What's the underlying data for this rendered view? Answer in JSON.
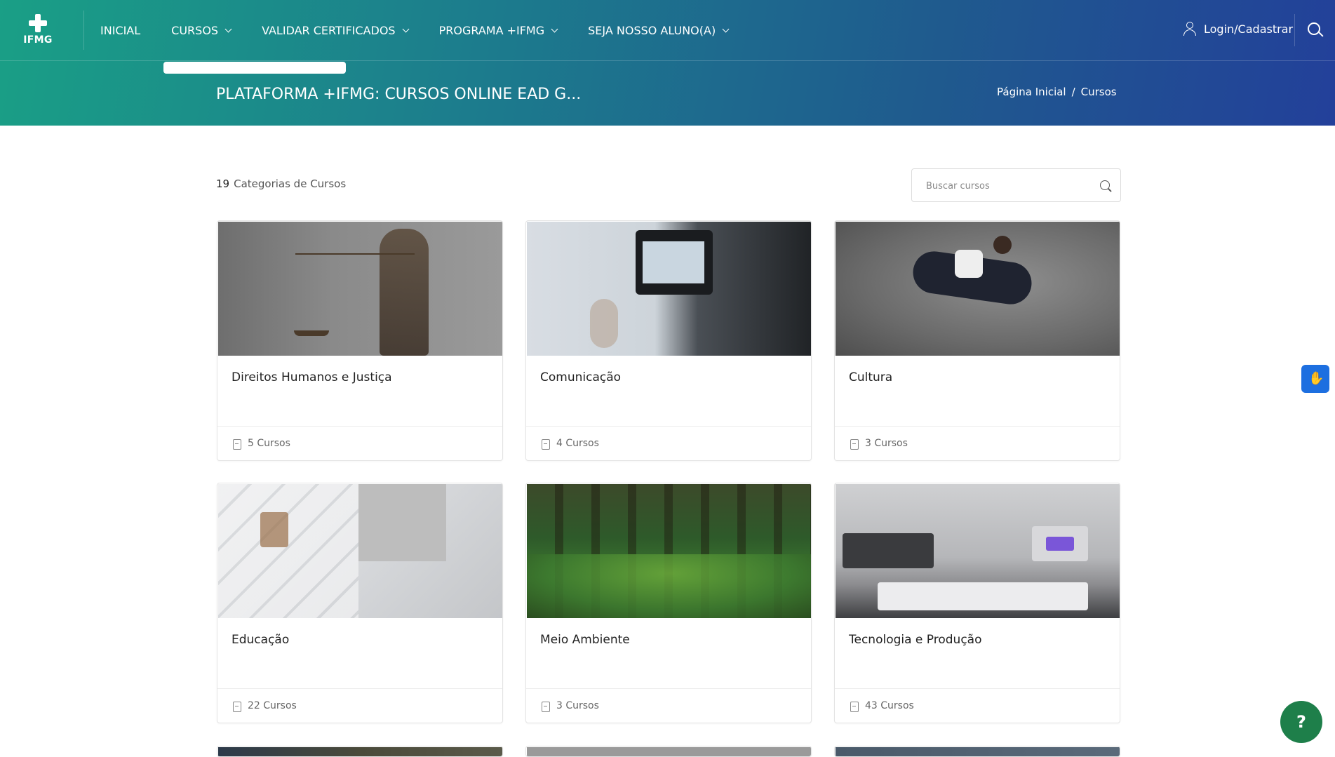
{
  "header": {
    "logo_text": "IFMG",
    "nav": [
      {
        "label": "INICIAL",
        "dropdown": false
      },
      {
        "label": "CURSOS",
        "dropdown": true
      },
      {
        "label": "VALIDAR CERTIFICADOS",
        "dropdown": true
      },
      {
        "label": "PROGRAMA +IFMG",
        "dropdown": true
      },
      {
        "label": "SEJA NOSSO ALUNO(A)",
        "dropdown": true
      }
    ],
    "login_label": "Login/Cadastrar",
    "page_title": "PLATAFORMA +IFMG: CURSOS ONLINE EAD G...",
    "breadcrumb": {
      "home": "Página Inicial",
      "separator": "/",
      "current": "Cursos"
    }
  },
  "toolbar": {
    "count_number": "19",
    "count_label": "Categorias de Cursos",
    "search_placeholder": "Buscar cursos"
  },
  "categories": [
    {
      "title": "Direitos Humanos e Justiça",
      "courses": "5 Cursos"
    },
    {
      "title": "Comunicação",
      "courses": "4 Cursos"
    },
    {
      "title": "Cultura",
      "courses": "3 Cursos"
    },
    {
      "title": "Educação",
      "courses": "22 Cursos"
    },
    {
      "title": "Meio Ambiente",
      "courses": "3 Cursos"
    },
    {
      "title": "Tecnologia e Produção",
      "courses": "43 Cursos"
    }
  ],
  "widgets": {
    "help_label": "?"
  },
  "colors": {
    "header_gradient_start": "#1a9f86",
    "header_gradient_end": "#23409a",
    "help_button": "#1e7f4a",
    "vlibras_button": "#1d6fe0"
  }
}
